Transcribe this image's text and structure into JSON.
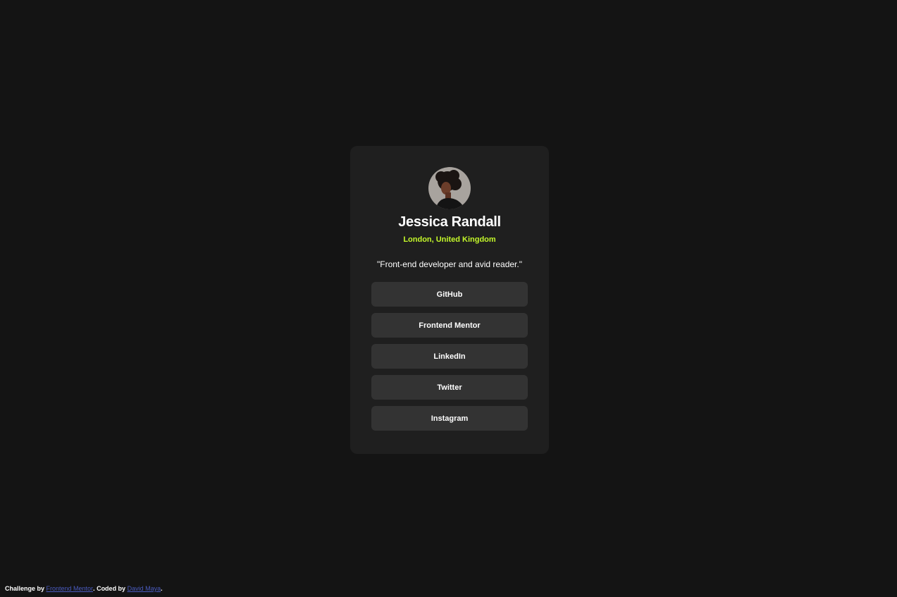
{
  "profile": {
    "name": "Jessica Randall",
    "location": "London, United Kingdom",
    "bio": "\"Front-end developer and avid reader.\""
  },
  "links": [
    {
      "label": "GitHub"
    },
    {
      "label": "Frontend Mentor"
    },
    {
      "label": "LinkedIn"
    },
    {
      "label": "Twitter"
    },
    {
      "label": "Instagram"
    }
  ],
  "footer": {
    "prefix": "Challenge by ",
    "challenge_link": "Frontend Mentor",
    "middle": ". Coded by ",
    "author_link": "David Maya",
    "suffix": "."
  },
  "colors": {
    "background": "#141414",
    "card": "#1f1f1f",
    "button": "#333333",
    "accent": "#c4f82a",
    "link": "#4a5bbf"
  }
}
